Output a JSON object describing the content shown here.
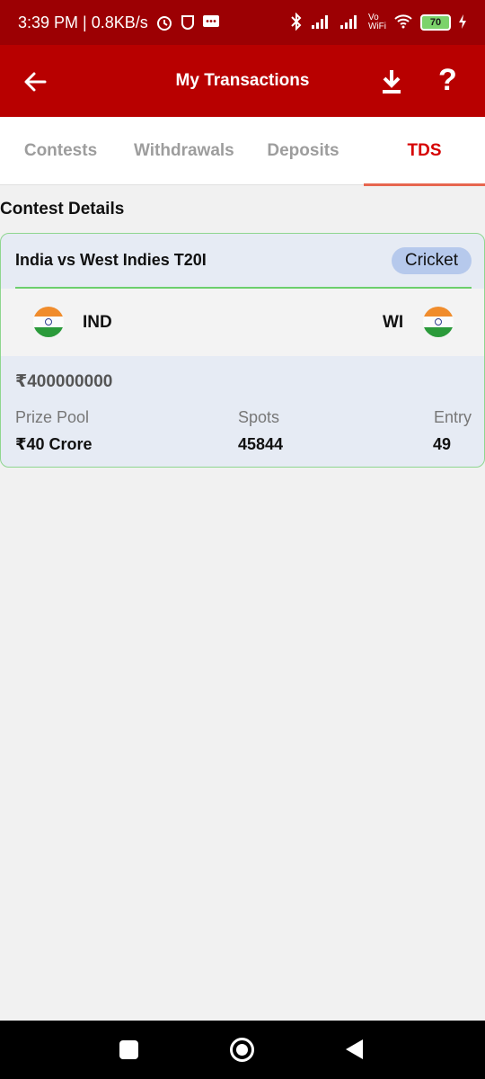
{
  "status_bar": {
    "time": "3:39 PM | 0.8KB/s",
    "wifi_label": "Vo\nWiFi",
    "battery": "70"
  },
  "app_bar": {
    "title": "My Transactions",
    "help_label": "?"
  },
  "tabs": [
    {
      "label": "Contests",
      "active": false
    },
    {
      "label": "Withdrawals",
      "active": false
    },
    {
      "label": "Deposits",
      "active": false
    },
    {
      "label": "TDS",
      "active": true
    }
  ],
  "section_title": "Contest Details",
  "contest": {
    "match_title": "India vs West Indies T20I",
    "sport": "Cricket",
    "team_left": "IND",
    "team_right": "WI",
    "amount": "₹400000000",
    "prize_pool_label": "Prize Pool",
    "prize_pool_value": "₹40 Crore",
    "spots_label": "Spots",
    "spots_value": "45844",
    "entry_label": "Entry",
    "entry_value": "49"
  },
  "colors": {
    "status_bar": "#9c0003",
    "app_bar": "#b80000",
    "active_tab": "#d60000",
    "card_border": "#8fd68f"
  }
}
